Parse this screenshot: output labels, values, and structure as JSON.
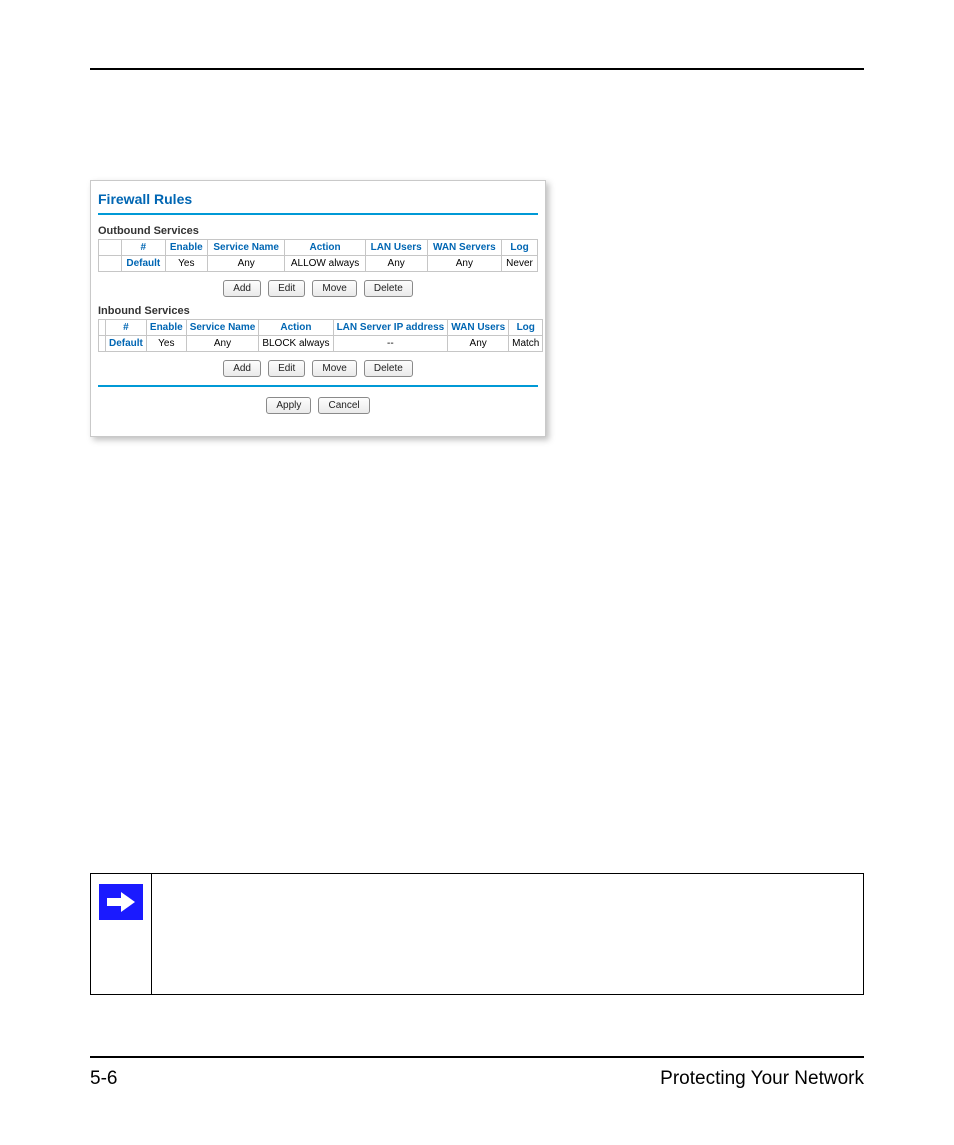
{
  "panel": {
    "title": "Firewall Rules",
    "outbound": {
      "label": "Outbound Services",
      "headers": [
        "#",
        "Enable",
        "Service Name",
        "Action",
        "LAN Users",
        "WAN Servers",
        "Log"
      ],
      "row": {
        "num": "Default",
        "enable": "Yes",
        "service": "Any",
        "action": "ALLOW always",
        "lan": "Any",
        "wan": "Any",
        "log": "Never"
      }
    },
    "inbound": {
      "label": "Inbound Services",
      "headers": [
        "#",
        "Enable",
        "Service Name",
        "Action",
        "LAN Server IP address",
        "WAN Users",
        "Log"
      ],
      "row": {
        "num": "Default",
        "enable": "Yes",
        "service": "Any",
        "action": "BLOCK always",
        "lan": "--",
        "wan": "Any",
        "log": "Match"
      }
    },
    "buttons": {
      "add": "Add",
      "edit": "Edit",
      "move": "Move",
      "delete": "Delete",
      "apply": "Apply",
      "cancel": "Cancel"
    }
  },
  "footer": {
    "page_number": "5-6",
    "section_title": "Protecting Your Network"
  }
}
